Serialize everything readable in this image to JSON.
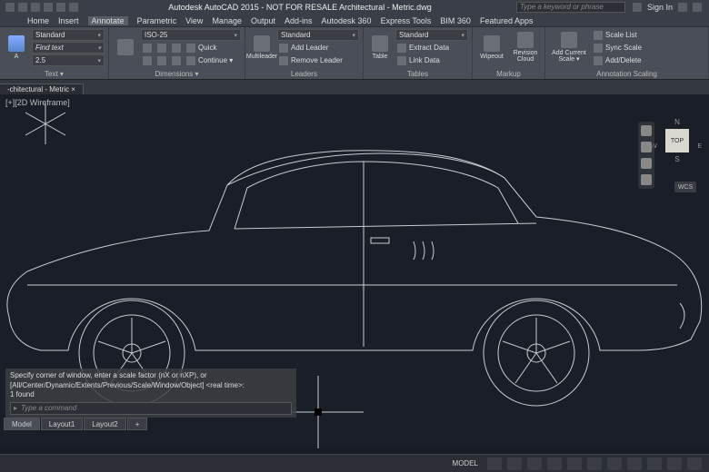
{
  "titlebar": {
    "title": "Autodesk AutoCAD 2015 - NOT FOR RESALE   Architectural - Metric.dwg",
    "search_placeholder": "Type a keyword or phrase",
    "signin": "Sign In"
  },
  "menus": [
    "Home",
    "Insert",
    "Annotate",
    "Parametric",
    "View",
    "Manage",
    "Output",
    "Add-ins",
    "Autodesk 360",
    "Express Tools",
    "BIM 360",
    "Featured Apps"
  ],
  "active_menu": "Annotate",
  "ribbon": {
    "text_panel": {
      "title": "Text ▾",
      "style": "Standard",
      "find": "Find text",
      "height": "2.5"
    },
    "dim_panel": {
      "title": "Dimensions ▾",
      "style": "ISO-25",
      "btns": [
        "",
        "",
        "",
        "Quick",
        "Continue ▾"
      ]
    },
    "leaders_panel": {
      "title": "Leaders",
      "big": "Multileader",
      "style": "Standard",
      "items": [
        "Add Leader",
        "Remove Leader"
      ]
    },
    "tables_panel": {
      "title": "Tables",
      "big": "Table",
      "style": "Standard",
      "items": [
        "Extract Data",
        "Link Data"
      ]
    },
    "markup_panel": {
      "title": "Markup",
      "btns": [
        "Wipeout",
        "Revision Cloud"
      ]
    },
    "scale_panel": {
      "title": "Annotation Scaling",
      "big": "Add Current Scale ▾",
      "items": [
        "Scale List",
        "Sync Scale",
        "Add/Delete"
      ]
    }
  },
  "file_tab": "-chitectural - Metric ×",
  "viewport_label": "[+][2D Wireframe]",
  "navcube": {
    "n": "N",
    "face": "TOP",
    "w": "W",
    "s": "S",
    "e": "E",
    "wcs": "WCS"
  },
  "command": {
    "line1": "Specify corner of window, enter a scale factor (nX or nXP), or",
    "line2": "[All/Center/Dynamic/Extents/Previous/Scale/Window/Object] <real time>:",
    "line3": "1 found",
    "prompt": "▸",
    "placeholder": "Type a command"
  },
  "layout_tabs": [
    "Model",
    "Layout1",
    "Layout2"
  ],
  "active_layout": "Model",
  "statusbar": {
    "model": "MODEL"
  }
}
